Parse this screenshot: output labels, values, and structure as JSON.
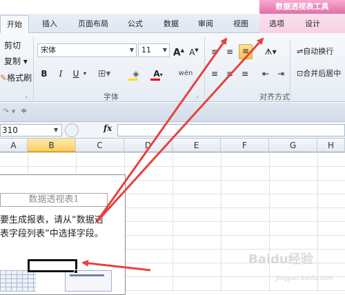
{
  "ribbon_context": {
    "title": "数据透视表工具",
    "tabs": [
      "选项",
      "设计"
    ]
  },
  "tabs": [
    "开始",
    "插入",
    "页面布局",
    "公式",
    "数据",
    "审阅",
    "视图"
  ],
  "clipboard": {
    "cut": "剪切",
    "copy": "复制 ▾",
    "format_painter": "格式刷"
  },
  "font": {
    "name": "宋体",
    "size": "11",
    "grow": "A",
    "shrink": "A",
    "bold": "B",
    "italic": "I",
    "underline": "U",
    "color_letter": "A",
    "phonetic": "wén",
    "group_label": "字体"
  },
  "alignment": {
    "wrap": "自动换行",
    "merge": "合并后居中",
    "group_label": "对齐方式"
  },
  "formula_bar": {
    "name_box": "310",
    "fx": "fx"
  },
  "columns": [
    "A",
    "B",
    "C",
    "D",
    "E",
    "F",
    "G",
    "H"
  ],
  "selected_column": "B",
  "pivot": {
    "title": "数据透视表1",
    "line1": "要生成报表，请从“数据透",
    "line2": "表字段列表”中选择字段。"
  },
  "watermark": {
    "main": "Baidu经验",
    "sub": "jingyan.baidu.com"
  },
  "colors": {
    "arrow": "#e8403c",
    "context": "#e070a8",
    "selected_header": "#f8cf6a"
  }
}
